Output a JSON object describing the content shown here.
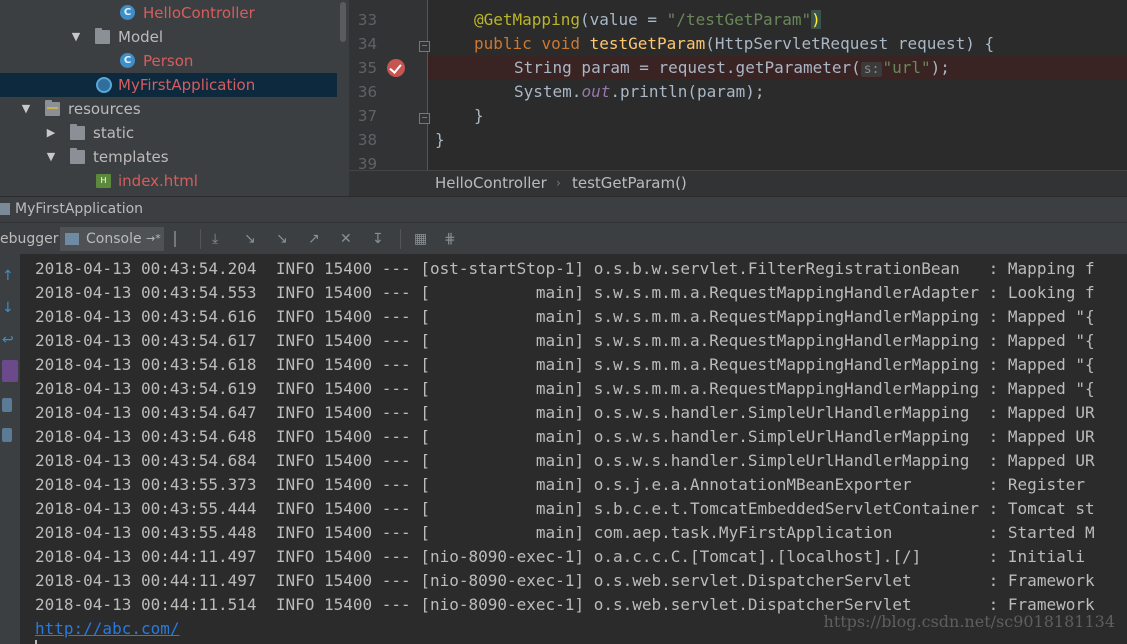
{
  "project_tree": {
    "items": [
      {
        "label": "HelloController",
        "kind": "class",
        "error": true
      },
      {
        "label": "Model",
        "kind": "folder",
        "expanded": true
      },
      {
        "label": "Person",
        "kind": "class",
        "error": true
      },
      {
        "label": "MyFirstApplication",
        "kind": "app-class",
        "error": true,
        "selected": true
      },
      {
        "label": "resources",
        "kind": "resource-folder",
        "expanded": true
      },
      {
        "label": "static",
        "kind": "folder",
        "expanded": false
      },
      {
        "label": "templates",
        "kind": "folder",
        "expanded": true
      },
      {
        "label": "index.html",
        "kind": "html",
        "error": true
      }
    ]
  },
  "editor": {
    "line_numbers": [
      "33",
      "34",
      "35",
      "36",
      "37",
      "38",
      "39"
    ],
    "code": {
      "l33_annotation": "@GetMapping",
      "l33_args_open": "(value = ",
      "l33_string": "\"/testGetParam\"",
      "l33_close": ")",
      "l34_kw1": "public",
      "l34_kw2": "void",
      "l34_method": "testGetParam",
      "l34_params": "(HttpServletRequest request) {",
      "l35_pre": "String param = request.getParameter(",
      "l35_hint": "s:",
      "l35_string": "\"url\"",
      "l35_post": ");",
      "l36_pre": "System.",
      "l36_field": "out",
      "l36_post": ".println(param);",
      "l37": "}",
      "l38": "}"
    },
    "breadcrumb": [
      "HelloController",
      "testGetParam()"
    ]
  },
  "run_window": {
    "title": "MyFirstApplication",
    "tabs": {
      "debugger": "ebugger",
      "console": "Console"
    },
    "console_pin": "→*"
  },
  "console": {
    "lines": [
      "2018-04-13 00:43:54.204  INFO 15400 --- [ost-startStop-1] o.s.b.w.servlet.FilterRegistrationBean   : Mapping f",
      "2018-04-13 00:43:54.553  INFO 15400 --- [           main] s.w.s.m.m.a.RequestMappingHandlerAdapter : Looking f",
      "2018-04-13 00:43:54.616  INFO 15400 --- [           main] s.w.s.m.m.a.RequestMappingHandlerMapping : Mapped \"{",
      "2018-04-13 00:43:54.617  INFO 15400 --- [           main] s.w.s.m.m.a.RequestMappingHandlerMapping : Mapped \"{",
      "2018-04-13 00:43:54.618  INFO 15400 --- [           main] s.w.s.m.m.a.RequestMappingHandlerMapping : Mapped \"{",
      "2018-04-13 00:43:54.619  INFO 15400 --- [           main] s.w.s.m.m.a.RequestMappingHandlerMapping : Mapped \"{",
      "2018-04-13 00:43:54.647  INFO 15400 --- [           main] o.s.w.s.handler.SimpleUrlHandlerMapping  : Mapped UR",
      "2018-04-13 00:43:54.648  INFO 15400 --- [           main] o.s.w.s.handler.SimpleUrlHandlerMapping  : Mapped UR",
      "2018-04-13 00:43:54.684  INFO 15400 --- [           main] o.s.w.s.handler.SimpleUrlHandlerMapping  : Mapped UR",
      "2018-04-13 00:43:55.373  INFO 15400 --- [           main] o.s.j.e.a.AnnotationMBeanExporter        : Register",
      "2018-04-13 00:43:55.444  INFO 15400 --- [           main] s.b.c.e.t.TomcatEmbeddedServletContainer : Tomcat st",
      "2018-04-13 00:43:55.448  INFO 15400 --- [           main] com.aep.task.MyFirstApplication          : Started M",
      "2018-04-13 00:44:11.497  INFO 15400 --- [nio-8090-exec-1] o.a.c.c.C.[Tomcat].[localhost].[/]       : Initiali",
      "2018-04-13 00:44:11.497  INFO 15400 --- [nio-8090-exec-1] o.s.web.servlet.DispatcherServlet        : Framework",
      "2018-04-13 00:44:11.514  INFO 15400 --- [nio-8090-exec-1] o.s.web.servlet.DispatcherServlet        : Framework"
    ],
    "output_link": "http://abc.com/"
  },
  "watermark": "https://blog.csdn.net/sc9018181134",
  "colors": {
    "background": "#2b2b2b",
    "panel": "#3c3f41",
    "error_text": "#d65d5d",
    "link": "#287bde",
    "keyword": "#cc7832",
    "string": "#6a8759",
    "annotation": "#bbb529",
    "breakpoint": "#c75450"
  }
}
